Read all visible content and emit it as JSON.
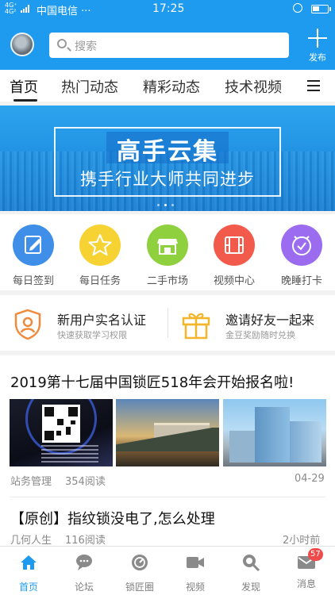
{
  "status": {
    "network": "4G⁺ 4G²",
    "carrier": "中国电信 ···",
    "time": "17:25"
  },
  "header": {
    "search_placeholder": "搜索",
    "publish_label": "发布"
  },
  "tabs": [
    {
      "label": "首页",
      "active": true
    },
    {
      "label": "热门动态"
    },
    {
      "label": "精彩动态"
    },
    {
      "label": "技术视频"
    }
  ],
  "banner": {
    "title": "高手云集",
    "subtitle": "携手行业大师共同进步"
  },
  "quick": [
    {
      "label": "每日签到",
      "icon": "edit-icon",
      "color": "#3f8ee8"
    },
    {
      "label": "每日任务",
      "icon": "star-icon",
      "color": "#f6d233"
    },
    {
      "label": "二手市场",
      "icon": "shop-icon",
      "color": "#8fd03e"
    },
    {
      "label": "视频中心",
      "icon": "film-icon",
      "color": "#f25b4b"
    },
    {
      "label": "晚睡打卡",
      "icon": "check-clock-icon",
      "color": "#9b6cf0"
    }
  ],
  "promo": [
    {
      "title": "新用户实名认证",
      "subtitle": "快速获取学习权限",
      "icon": "id-shield-icon"
    },
    {
      "title": "邀请好友一起来",
      "subtitle": "金豆奖励随时兑换",
      "icon": "gift-icon"
    }
  ],
  "articles": [
    {
      "title": "2019第十七届中国锁匠518年会开始报名啦!",
      "author": "站务管理",
      "reads": "354阅读",
      "time": "04-29"
    },
    {
      "title": "【原创】指纹锁没电了,怎么处理",
      "author": "几何人生",
      "reads": "116阅读",
      "time": "2小时前"
    }
  ],
  "bottom_nav": [
    {
      "label": "首页",
      "icon": "home-icon",
      "active": true
    },
    {
      "label": "论坛",
      "icon": "chat-icon"
    },
    {
      "label": "锁匠圈",
      "icon": "circle-icon"
    },
    {
      "label": "视频",
      "icon": "video-icon"
    },
    {
      "label": "发现",
      "icon": "discover-icon"
    },
    {
      "label": "消息",
      "icon": "mail-icon",
      "badge": "57"
    }
  ],
  "colors": {
    "brand": "#1e9bef",
    "badge": "#f04b4b"
  }
}
